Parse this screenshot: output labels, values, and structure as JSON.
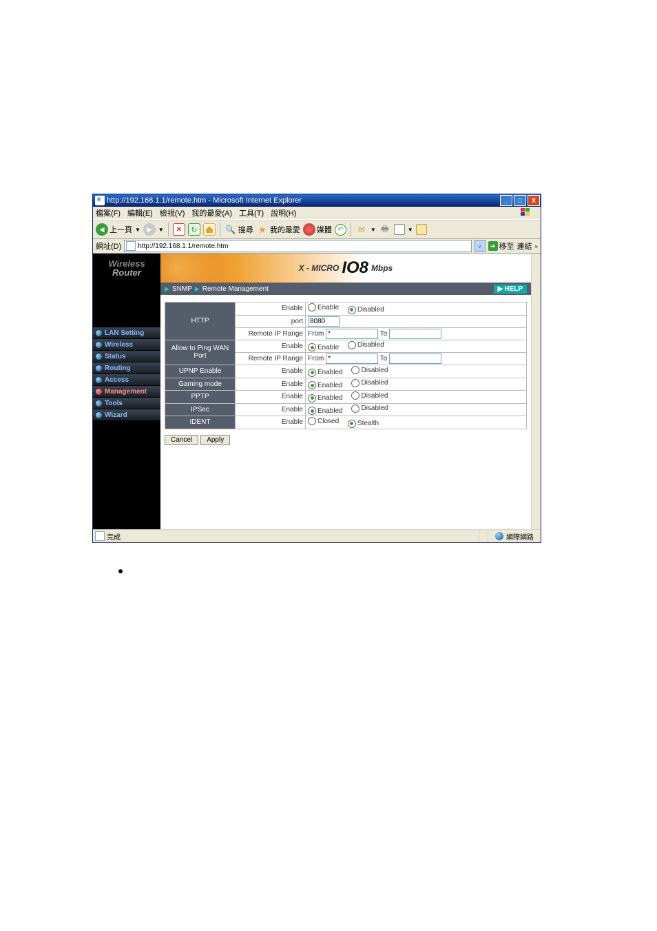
{
  "window": {
    "title": "http://192.168.1.1/remote.htm - Microsoft Internet Explorer"
  },
  "menu": {
    "file": "檔案(F)",
    "edit": "編輯(E)",
    "view": "檢視(V)",
    "fav": "我的最愛(A)",
    "tools": "工具(T)",
    "help": "說明(H)"
  },
  "toolbar": {
    "back": "上一頁",
    "search": "搜尋",
    "fav": "我的最愛",
    "media": "媒體"
  },
  "address": {
    "label": "網址(D)",
    "value": "http://192.168.1.1/remote.htm",
    "go": "移至",
    "links": "連結"
  },
  "logo": {
    "l1": "Wireless",
    "l2": "Router"
  },
  "nav": {
    "items": [
      {
        "label": "LAN Setting"
      },
      {
        "label": "Wireless"
      },
      {
        "label": "Status"
      },
      {
        "label": "Routing"
      },
      {
        "label": "Access"
      },
      {
        "label": "Management"
      },
      {
        "label": "Tools"
      },
      {
        "label": "Wizard"
      }
    ]
  },
  "banner": {
    "brand": "X - MICRO",
    "model": "IO8",
    "unit": "Mbps"
  },
  "crumb": {
    "a": "SNMP",
    "b": "Remote Management",
    "help": "HELP"
  },
  "cfg": {
    "http": {
      "name": "HTTP",
      "row1": "Enable",
      "opt_en": "Enable",
      "opt_dis": "Disabled",
      "row2": "port",
      "port": "8080",
      "row3": "Remote IP Range",
      "from": "From",
      "from_val": "*",
      "to": "To",
      "to_val": ""
    },
    "ping": {
      "name": "Allow to Ping WAN Port",
      "row1": "Enable",
      "opt_en": "Enable",
      "opt_dis": "Disabled",
      "row2": "Remote IP Range",
      "from": "From",
      "from_val": "*",
      "to": "To",
      "to_val": ""
    },
    "upnp": {
      "name": "UPNP Enable",
      "row": "Enable",
      "opt_en": "Enabled",
      "opt_dis": "Disabled"
    },
    "gaming": {
      "name": "Gaming mode",
      "row": "Enable",
      "opt_en": "Enabled",
      "opt_dis": "Disabled"
    },
    "pptp": {
      "name": "PPTP",
      "row": "Enable",
      "opt_en": "Enabled",
      "opt_dis": "Disabled"
    },
    "ipsec": {
      "name": "IPSec",
      "row": "Enable",
      "opt_en": "Enabled",
      "opt_dis": "Disabled"
    },
    "ident": {
      "name": "IDENT",
      "row": "Enable",
      "opt_cl": "Closed",
      "opt_st": "Stealth"
    }
  },
  "buttons": {
    "cancel": "Cancel",
    "apply": "Apply"
  },
  "status": {
    "done": "完成",
    "zone": "網際網路"
  }
}
